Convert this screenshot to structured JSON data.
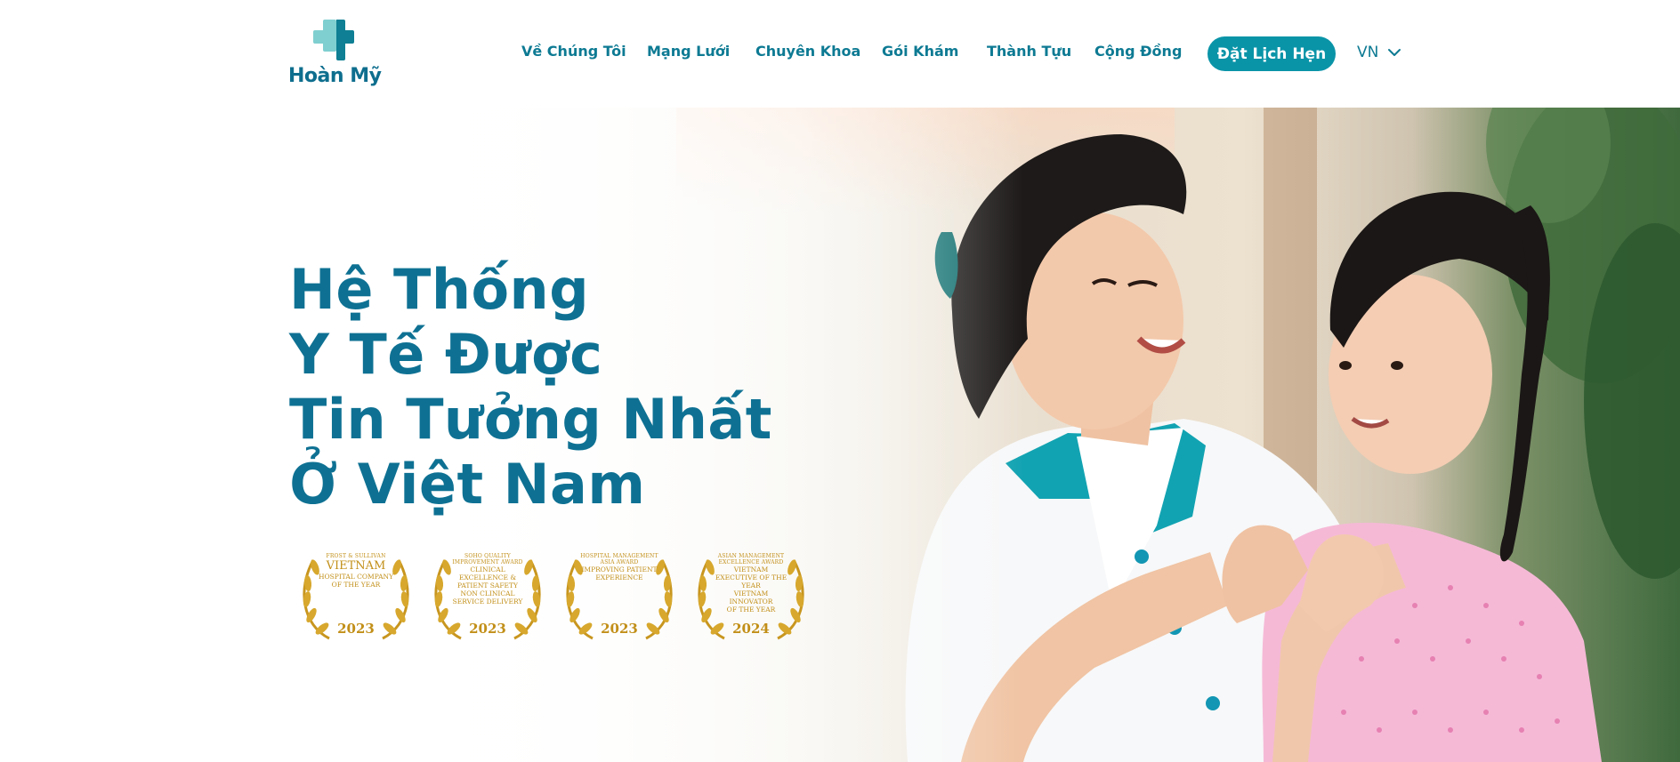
{
  "brand": {
    "logo_text": "Hoàn Mỹ",
    "primary_color": "#0e7193",
    "accent_color": "#0a94a8",
    "logo_light_color": "#7fcfd0"
  },
  "nav": {
    "items": [
      {
        "label": "Về Chúng Tôi"
      },
      {
        "label": "Mạng Lưới"
      },
      {
        "label": "Chuyên Khoa"
      },
      {
        "label": "Gói Khám"
      },
      {
        "label": "Thành Tựu"
      },
      {
        "label": "Cộng Đồng"
      }
    ],
    "cta_label": "Đặt Lịch Hẹn",
    "language": "VN",
    "language_icon": "chevron-down-icon"
  },
  "hero": {
    "title_lines": [
      "Hệ Thống",
      "Y Tế Được",
      "Tin Tưởng Nhất",
      "Ở Việt Nam"
    ],
    "image": "nurse-and-girl-heart-hands-photo",
    "awards": [
      {
        "top": "FROST & SULLIVAN",
        "main": "VIETNAM",
        "sub1": "HOSPITAL COMPANY",
        "sub2": "OF THE YEAR",
        "year": "2023"
      },
      {
        "top": "SOHO QUALITY IMPROVEMENT AWARD",
        "main": "CLINICAL EXCELLENCE & PATIENT SAFETY",
        "sub1": "NON CLINICAL",
        "sub2": "SERVICE DELIVERY",
        "year": "2023"
      },
      {
        "top": "HOSPITAL MANAGEMENT ASIA AWARD",
        "main": "IMPROVING PATIENT",
        "sub1": "EXPERIENCE",
        "sub2": "",
        "year": "2023"
      },
      {
        "top": "ASIAN MANAGEMENT EXCELLENCE AWARD",
        "main": "VIETNAM EXECUTIVE OF THE YEAR",
        "sub1": "VIETNAM INNOVATOR",
        "sub2": "OF THE YEAR",
        "year": "2024"
      }
    ]
  }
}
